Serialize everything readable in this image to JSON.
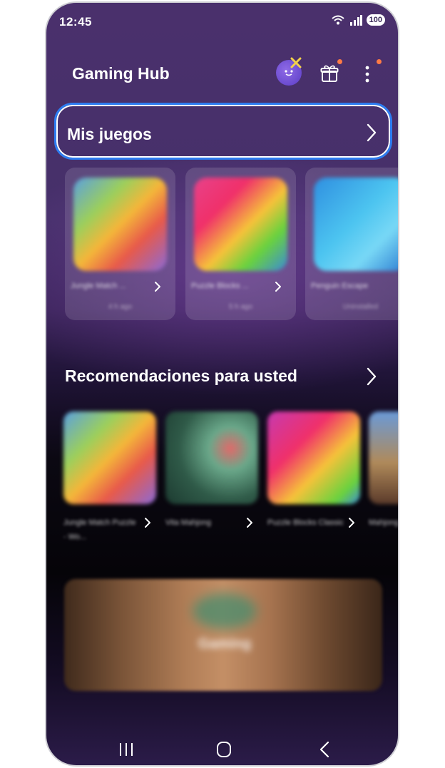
{
  "status_bar": {
    "time": "12:45",
    "battery": "100"
  },
  "header": {
    "title": "Gaming Hub"
  },
  "my_games": {
    "label": "Mis juegos",
    "games": [
      {
        "name": "Jungle Match ...",
        "meta": "4 h ago"
      },
      {
        "name": "Puzzle Blocks ...",
        "meta": "5 h ago"
      },
      {
        "name": "Penguin Escape",
        "meta": "Uninstalled"
      }
    ]
  },
  "recommendations": {
    "title": "Recomendaciones para usted",
    "games": [
      {
        "name": "Jungle Match Puzzle - Wo..."
      },
      {
        "name": "Vita Mahjong"
      },
      {
        "name": "Puzzle Blocks Classic"
      },
      {
        "name": "Mahjong"
      }
    ]
  },
  "banner": {
    "label": "Gaming"
  },
  "colors": {
    "focus_ring": "#2d7cf0",
    "notification_dot": "#ff7a45",
    "avatar": "#6e4ad6"
  },
  "icons": [
    "wifi-icon",
    "signal-icon",
    "gift-icon",
    "more-icon",
    "chevron-right-icon",
    "recents-icon",
    "home-icon",
    "back-icon"
  ]
}
